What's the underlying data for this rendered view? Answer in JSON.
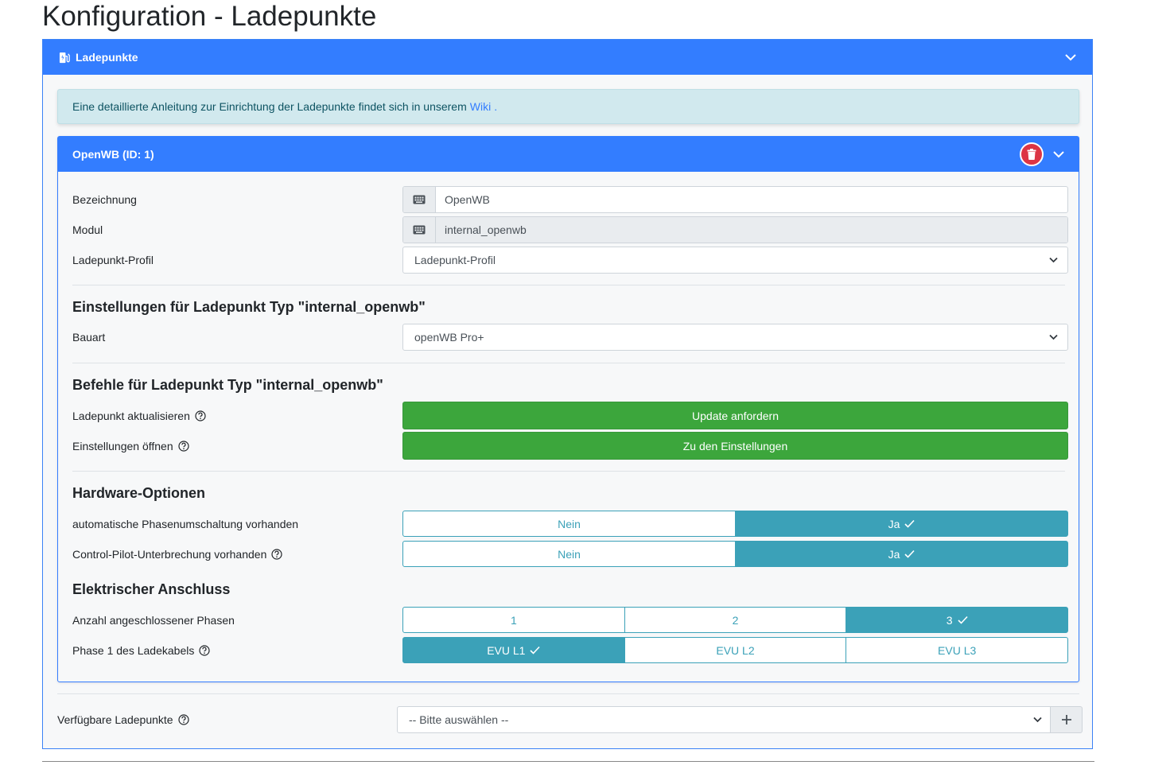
{
  "page": {
    "title": "Konfiguration - Ladepunkte"
  },
  "card": {
    "header": "Ladepunkte"
  },
  "alert": {
    "text": "Eine detaillierte Anleitung zur Einrichtung der Ladepunkte findet sich in unserem",
    "link": "Wiki",
    "suffix": "."
  },
  "chargepoint": {
    "header": "OpenWB (ID: 1)",
    "fields": {
      "name": {
        "label": "Bezeichnung",
        "value": "OpenWB"
      },
      "module": {
        "label": "Modul",
        "value": "internal_openwb"
      },
      "profile": {
        "label": "Ladepunkt-Profil",
        "value": "Ladepunkt-Profil"
      }
    },
    "settings": {
      "title": "Einstellungen für Ladepunkt Typ \"internal_openwb\"",
      "build": {
        "label": "Bauart",
        "value": "openWB Pro+"
      }
    },
    "commands": {
      "title": "Befehle für Ladepunkt Typ \"internal_openwb\"",
      "update": {
        "label": "Ladepunkt aktualisieren",
        "button": "Update anfordern"
      },
      "open_settings": {
        "label": "Einstellungen öffnen",
        "button": "Zu den Einstellungen"
      }
    },
    "hardware": {
      "title": "Hardware-Optionen",
      "phase_switch": {
        "label": "automatische Phasenumschaltung vorhanden",
        "no": "Nein",
        "yes": "Ja",
        "selected": "yes"
      },
      "cp_interrupt": {
        "label": "Control-Pilot-Unterbrechung vorhanden",
        "no": "Nein",
        "yes": "Ja",
        "selected": "yes"
      }
    },
    "electrical": {
      "title": "Elektrischer Anschluss",
      "phases": {
        "label": "Anzahl angeschlossener Phasen",
        "options": [
          "1",
          "2",
          "3"
        ],
        "selected": "3"
      },
      "phase1": {
        "label": "Phase 1 des Ladekabels",
        "options": [
          "EVU L1",
          "EVU L2",
          "EVU L3"
        ],
        "selected": "EVU L1"
      }
    }
  },
  "available": {
    "label": "Verfügbare Ladepunkte",
    "placeholder": "-- Bitte auswählen --"
  },
  "icons": {
    "ev-station-icon": "ev-station",
    "chevron-down-icon": "chevron-down",
    "trash-icon": "trash",
    "keyboard-icon": "keyboard",
    "question-circle-icon": "question-circle",
    "check-icon": "check",
    "plus-icon": "plus"
  },
  "colors": {
    "primary": "#337dff",
    "success": "#3ca63c",
    "info": "#3ba1b8",
    "danger": "#dc3545",
    "alert_bg": "#d1e9ee"
  }
}
